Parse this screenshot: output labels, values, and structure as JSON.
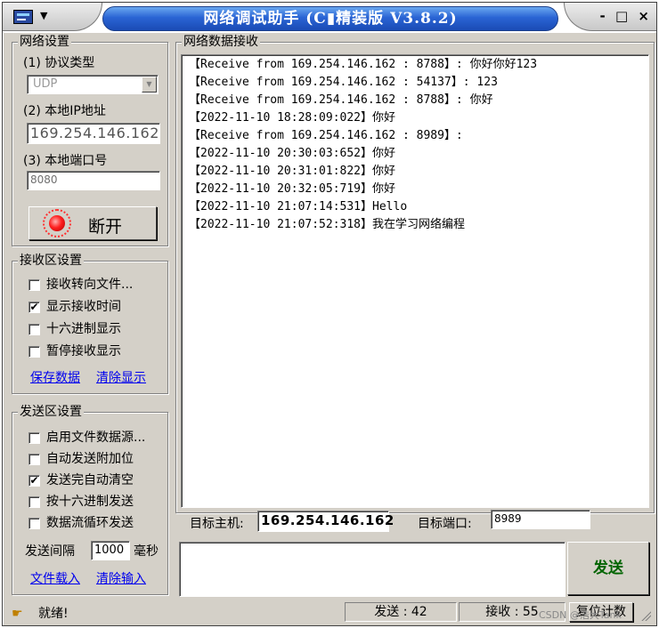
{
  "window": {
    "title": "网络调试助手 (C▮精装版 V3.8.2)",
    "controls": {
      "minimize": "-",
      "maximize": "□",
      "close": "×"
    }
  },
  "network_settings": {
    "group_title": "网络设置",
    "protocol_label": "(1) 协议类型",
    "protocol_value": "UDP",
    "local_ip_label": "(2) 本地IP地址",
    "local_ip_value": "169.254.146.162",
    "local_port_label": "(3) 本地端口号",
    "local_port_value": "8080",
    "disconnect_label": "断开"
  },
  "receive_settings": {
    "group_title": "接收区设置",
    "options": [
      {
        "label": "接收转向文件...",
        "checked": false
      },
      {
        "label": "显示接收时间",
        "checked": true
      },
      {
        "label": "十六进制显示",
        "checked": false
      },
      {
        "label": "暂停接收显示",
        "checked": false
      }
    ],
    "save_link": "保存数据",
    "clear_link": "清除显示"
  },
  "send_settings": {
    "group_title": "发送区设置",
    "options": [
      {
        "label": "启用文件数据源...",
        "checked": false
      },
      {
        "label": "自动发送附加位",
        "checked": false
      },
      {
        "label": "发送完自动清空",
        "checked": true
      },
      {
        "label": "按十六进制发送",
        "checked": false
      },
      {
        "label": "数据流循环发送",
        "checked": false
      }
    ],
    "interval_label": "发送间隔",
    "interval_value": "1000",
    "interval_unit": "毫秒",
    "load_link": "文件载入",
    "clear_link": "清除输入"
  },
  "receive_area": {
    "group_title": "网络数据接收",
    "lines": [
      "【Receive from 169.254.146.162 : 8788】: 你好你好123",
      "【Receive from 169.254.146.162 : 54137】: 123",
      "【Receive from 169.254.146.162 : 8788】: 你好",
      "【2022-11-10 18:28:09:022】你好",
      "【Receive from 169.254.146.162 : 8989】:",
      "【2022-11-10 20:30:03:652】你好",
      "【2022-11-10 20:31:01:822】你好",
      "【2022-11-10 20:32:05:719】你好",
      "【2022-11-10 21:07:14:531】Hello",
      "【2022-11-10 21:07:52:318】我在学习网络编程"
    ]
  },
  "target": {
    "host_label": "目标主机:",
    "host_value": "169.254.146.162",
    "port_label": "目标端口:",
    "port_value": "8989"
  },
  "send_area": {
    "input_value": "",
    "send_button_label": "发送"
  },
  "status_bar": {
    "status_text": "就绪!",
    "sent_label": "发送 : 42",
    "received_label": "接收 : 55",
    "reset_label": "复位计数",
    "watermark": "CSDN @浩大Tank"
  },
  "colors": {
    "title_blue": "#2a64d4",
    "window_face": "#d4d0c8",
    "link_blue": "#0000ee",
    "send_green": "#006400",
    "led_red": "#ff2020"
  }
}
